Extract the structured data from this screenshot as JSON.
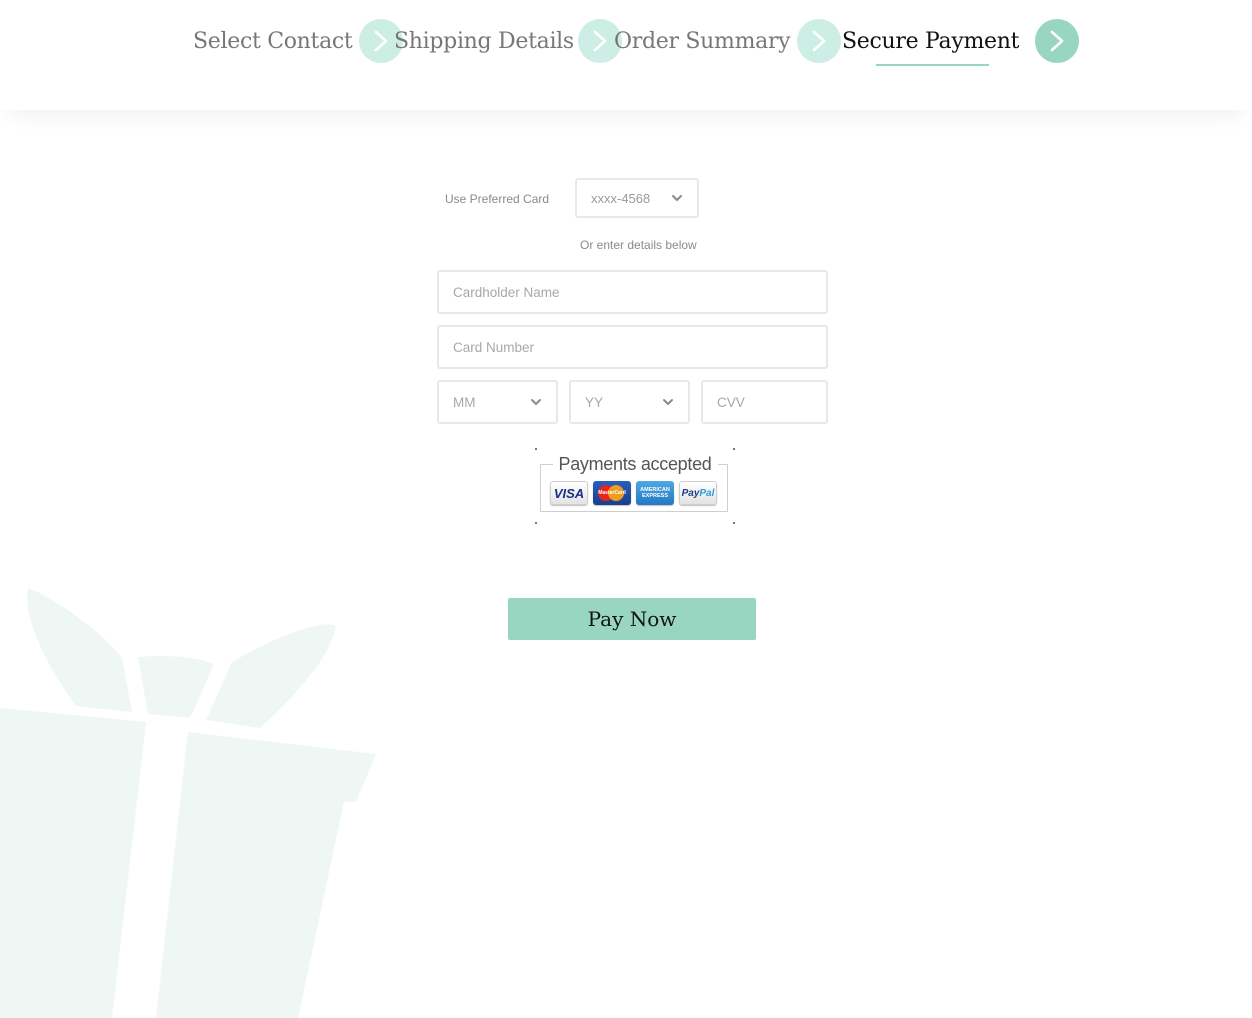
{
  "stepper": {
    "steps": [
      {
        "label": "Select Contact",
        "active": false
      },
      {
        "label": "Shipping Details",
        "active": false
      },
      {
        "label": "Order Summary",
        "active": false
      },
      {
        "label": "Secure Payment",
        "active": true
      }
    ],
    "circle_color": "#cdeee4",
    "active_circle_color": "#98d6c2"
  },
  "payment_form": {
    "preferred_card_label": "Use Preferred Card",
    "preferred_card_value": "xxxx-4568",
    "or_text": "Or enter details below",
    "cardholder_placeholder": "Cardholder Name",
    "card_number_placeholder": "Card Number",
    "month_placeholder": "MM",
    "year_placeholder": "YY",
    "cvv_placeholder": "CVV"
  },
  "payments_accepted": {
    "title": "Payments accepted",
    "cards": {
      "visa": "VISA",
      "mastercard": "MasterCard",
      "amex_line1": "AMERICAN",
      "amex_line2": "EXPRESS",
      "paypal_pay": "Pay",
      "paypal_pal": "Pal"
    }
  },
  "pay_button": {
    "label": "Pay Now",
    "color": "#98d6c2"
  },
  "decor": {
    "gift_color": "#eef7f4"
  }
}
